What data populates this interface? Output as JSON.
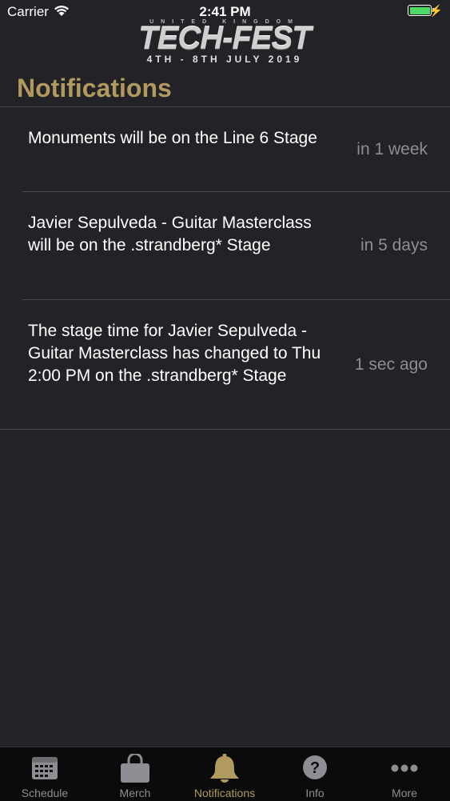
{
  "status_bar": {
    "carrier": "Carrier",
    "time": "2:41 PM"
  },
  "logo": {
    "top_line": "UNITED KINGDOM",
    "main": "TECH-FEST",
    "date_line": "4TH - 8TH JULY 2019"
  },
  "page": {
    "title": "Notifications"
  },
  "notifications": [
    {
      "message": "Monuments will be on the Line 6 Stage",
      "when": "in 1 week"
    },
    {
      "message": "Javier Sepulveda - Guitar Masterclass will be on the .strandberg* Stage",
      "when": "in 5 days"
    },
    {
      "message": "The stage time for Javier Sepulveda - Guitar Masterclass has changed to Thu 2:00 PM on the .strandberg* Stage",
      "when": "1 sec ago"
    }
  ],
  "tabs": [
    {
      "label": "Schedule",
      "icon": "calendar-icon"
    },
    {
      "label": "Merch",
      "icon": "shopping-bag-icon"
    },
    {
      "label": "Notifications",
      "icon": "bell-icon",
      "active": true
    },
    {
      "label": "Info",
      "icon": "question-icon"
    },
    {
      "label": "More",
      "icon": "more-dots-icon"
    }
  ],
  "colors": {
    "background": "#232227",
    "accent": "#b19a5d",
    "secondary_text": "#8e8d93",
    "battery": "#4cd964"
  }
}
